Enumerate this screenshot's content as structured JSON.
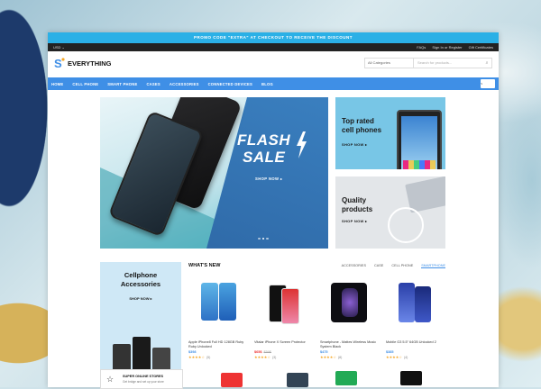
{
  "promo_bar": {
    "text": "PROMO CODE \"EXTRA\" AT CHECKOUT TO RECEIVE THE DISCOUNT"
  },
  "top_bar": {
    "currency": "USD ⌄",
    "links": [
      "FAQs",
      "Sign In or Register",
      "Gift Certificates"
    ]
  },
  "header": {
    "logo_text": "EVERYTHING",
    "search": {
      "category": "All Categories",
      "placeholder": "Search for products..."
    }
  },
  "nav": {
    "items": [
      "HOME",
      "CELL PHONE",
      "SMART PHONE",
      "CASES",
      "ACCESSORIES",
      "CONNECTED DEVICES",
      "BLOG"
    ],
    "cart_count": "0"
  },
  "hero": {
    "title_line1": "FLASH",
    "title_line2": "SALE",
    "cta": "SHOP NOW ▸"
  },
  "side_banners": [
    {
      "title_line1": "Top rated",
      "title_line2": "cell phones",
      "cta": "SHOP NOW ▸"
    },
    {
      "title_line1": "Quality",
      "title_line2": "products",
      "cta": "SHOP NOW ▸"
    }
  ],
  "promo_side": {
    "title_line1": "Cellphone",
    "title_line2": "Accessories",
    "cta": "SHOP NOW ▸"
  },
  "whats_new": {
    "heading": "WHAT'S NEW",
    "tabs": [
      "ACCESSORIES",
      "CASE",
      "CELL PHONE",
      "SMARTPHONE"
    ],
    "active_tab": "SMARTPHONE",
    "products": [
      {
        "name": "Apple iPhone8 Full HD 128GB Ruby Ruby Unlocked",
        "price": "$398",
        "old_price": "",
        "reviews": "(5)"
      },
      {
        "name": "Vitalar iPhone X Screen Protector",
        "price": "$65$",
        "old_price": "$59$",
        "reviews": "(3)"
      },
      {
        "name": "Smartphone - Mattes Wireless Music System Black",
        "price": "$475",
        "old_price": "",
        "reviews": "(8)"
      },
      {
        "name": "Mobile G3 5.5\" 64GB Unlocked 2",
        "price": "$385",
        "old_price": "",
        "reviews": "(4)"
      }
    ]
  },
  "feature_box": {
    "title": "SUPER ONLINE STORES",
    "subtitle": "Get bridge and set up your store"
  },
  "colors": {
    "accent": "#3f8fe6",
    "promo": "#2bb0e6",
    "topbar": "#222222",
    "banner_blue": "#78c6e6"
  }
}
